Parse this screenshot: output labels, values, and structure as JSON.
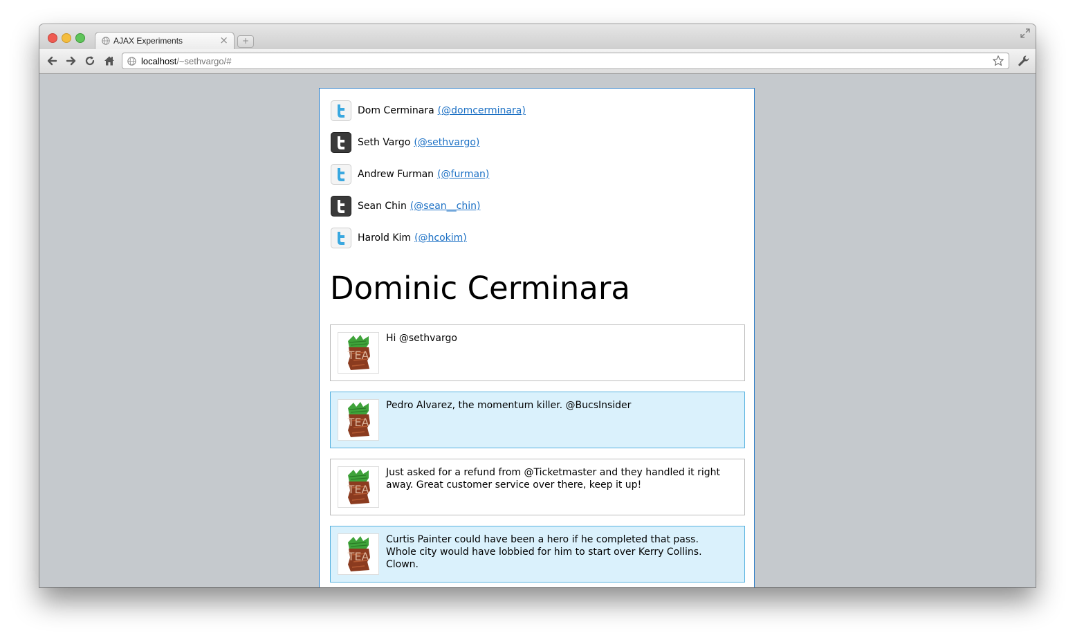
{
  "browser": {
    "tab_title": "AJAX Experiments",
    "tab_close": "×",
    "new_tab": "+",
    "url_host": "localhost",
    "url_path": "/~sethvargo/#"
  },
  "icons": {
    "back": "back-arrow-icon",
    "forward": "forward-arrow-icon",
    "reload": "reload-icon",
    "home": "home-icon",
    "bookmark": "star-icon",
    "settings": "wrench-icon",
    "twitter": "twitter-bird-icon"
  },
  "colors": {
    "link": "#1a6fc4",
    "twitter_blue": "#3aa8e0",
    "alt_tweet_bg": "#daf1fc",
    "alt_tweet_border": "#55b1df",
    "page_border": "#2a7cc7"
  },
  "users": [
    {
      "name": "Dom Cerminara",
      "handle": "(@domcerminara)",
      "icon_style": "light"
    },
    {
      "name": "Seth Vargo",
      "handle": "(@sethvargo)",
      "icon_style": "dark"
    },
    {
      "name": "Andrew Furman",
      "handle": "(@furman)",
      "icon_style": "light"
    },
    {
      "name": "Sean Chin",
      "handle": "(@sean__chin)",
      "icon_style": "dark"
    },
    {
      "name": "Harold Kim",
      "handle": "(@hcokim)",
      "icon_style": "light"
    }
  ],
  "profile": {
    "title": "Dominic Cerminara"
  },
  "tweets": [
    {
      "text": "Hi @sethvargo",
      "highlighted": false
    },
    {
      "text": "Pedro Alvarez, the momentum killer. @BucsInsider",
      "highlighted": true
    },
    {
      "text": "Just asked for a refund from @Ticketmaster and they handled it right away. Great customer service over there, keep it up!",
      "highlighted": false
    },
    {
      "text": "Curtis Painter could have been a hero if he completed that pass. Whole city would have lobbied for him to start over Kerry Collins. Clown.",
      "highlighted": true
    }
  ]
}
